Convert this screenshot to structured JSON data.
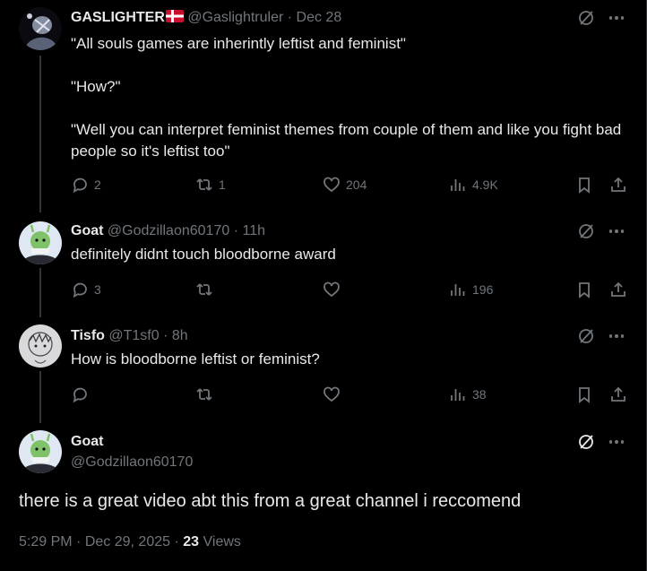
{
  "tweets": [
    {
      "name": "GASLIGHTER",
      "flag": "🇩🇰",
      "handle": "@Gaslightruler",
      "sep": "·",
      "time": "Dec 28",
      "text": [
        "\"All souls games are inherintly leftist and feminist\"",
        "\"How?\"",
        "\"Well you can interpret feminist themes from couple of them and like you fight bad people so it's leftist too\""
      ],
      "stats": {
        "replies": "2",
        "reposts": "1",
        "likes": "204",
        "views": "4.9K"
      }
    },
    {
      "name": "Goat",
      "handle": "@Godzillaon60170",
      "sep": "·",
      "time": "11h",
      "text": [
        "definitely didnt touch bloodborne award"
      ],
      "stats": {
        "replies": "3",
        "reposts": "",
        "likes": "",
        "views": "196"
      }
    },
    {
      "name": "Tisfo",
      "handle": "@T1sf0",
      "sep": "·",
      "time": "8h",
      "text": [
        "How is bloodborne leftist or feminist?"
      ],
      "stats": {
        "replies": "",
        "reposts": "",
        "likes": "",
        "views": "38"
      }
    }
  ],
  "focal": {
    "name": "Goat",
    "handle": "@Godzillaon60170",
    "text": "there is a great video abt this from a great channel i reccomend",
    "time": "5:29 PM",
    "sep1": "·",
    "date": "Dec 29, 2025",
    "sep2": "·",
    "views_count": "23",
    "views_label": "Views"
  },
  "colors": {
    "background": "#000000",
    "text": "#e7e9ea",
    "muted": "#71767b",
    "thread_line": "#333639"
  },
  "icons": [
    "reply-icon",
    "repost-icon",
    "like-icon",
    "views-icon",
    "bookmark-icon",
    "share-icon",
    "grok-icon",
    "more-icon"
  ]
}
